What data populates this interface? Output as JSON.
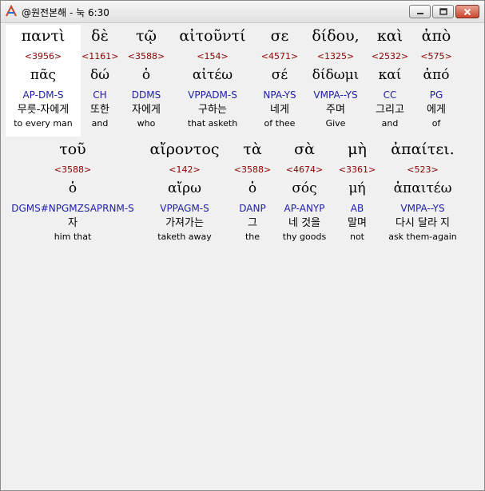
{
  "window": {
    "title": "@원전본해 - 눅 6:30",
    "accent_color": "#c8462d"
  },
  "words": [
    {
      "greek": "παντὶ",
      "strong": "<3956>",
      "lemma": "πᾶς",
      "parse": "AP-DM-S",
      "korean": "무릇-자에게",
      "english": "to every man"
    },
    {
      "greek": "δὲ",
      "strong": "<1161>",
      "lemma": "δώ",
      "parse": "CH",
      "korean": "또한",
      "english": "and"
    },
    {
      "greek": "τῷ",
      "strong": "<3588>",
      "lemma": "ὁ",
      "parse": "DDMS",
      "korean": "자에게",
      "english": "who"
    },
    {
      "greek": "αἰτοῦντί",
      "strong": "<154>",
      "lemma": "αἰτέω",
      "parse": "VPPADM-S",
      "korean": "구하는",
      "english": "that asketh"
    },
    {
      "greek": "σε",
      "strong": "<4571>",
      "lemma": "σέ",
      "parse": "NPA-YS",
      "korean": "네게",
      "english": "of thee"
    },
    {
      "greek": "δίδου,",
      "strong": "<1325>",
      "lemma": "δίδωμι",
      "parse": "VMPA--YS",
      "korean": "주며",
      "english": "Give"
    },
    {
      "greek": "καὶ",
      "strong": "<2532>",
      "lemma": "καί",
      "parse": "CC",
      "korean": "그리고",
      "english": "and"
    },
    {
      "greek": "ἀπὸ",
      "strong": "<575>",
      "lemma": "ἀπό",
      "parse": "PG",
      "korean": "에게",
      "english": "of"
    },
    {
      "greek": "τοῦ",
      "strong": "<3588>",
      "lemma": "ὁ",
      "parse": "DGMS#NPGMZSAPRNM-S",
      "korean": "자",
      "english": "him that"
    },
    {
      "greek": "αἴροντος",
      "strong": "<142>",
      "lemma": "αἴρω",
      "parse": "VPPAGM-S",
      "korean": "가져가는",
      "english": "taketh away"
    },
    {
      "greek": "τὰ",
      "strong": "<3588>",
      "lemma": "ὁ",
      "parse": "DANP",
      "korean": "그",
      "english": "the"
    },
    {
      "greek": "σὰ",
      "strong": "<4674>",
      "lemma": "σός",
      "parse": "AP-ANYP",
      "korean": "네 것을",
      "english": "thy goods"
    },
    {
      "greek": "μὴ",
      "strong": "<3361>",
      "lemma": "μή",
      "parse": "AB",
      "korean": "말며",
      "english": "not"
    },
    {
      "greek": "ἀπαίτει.",
      "strong": "<523>",
      "lemma": "ἀπαιτέω",
      "parse": "VMPA--YS",
      "korean": "다시 달라 지",
      "english": "ask them-again"
    }
  ]
}
